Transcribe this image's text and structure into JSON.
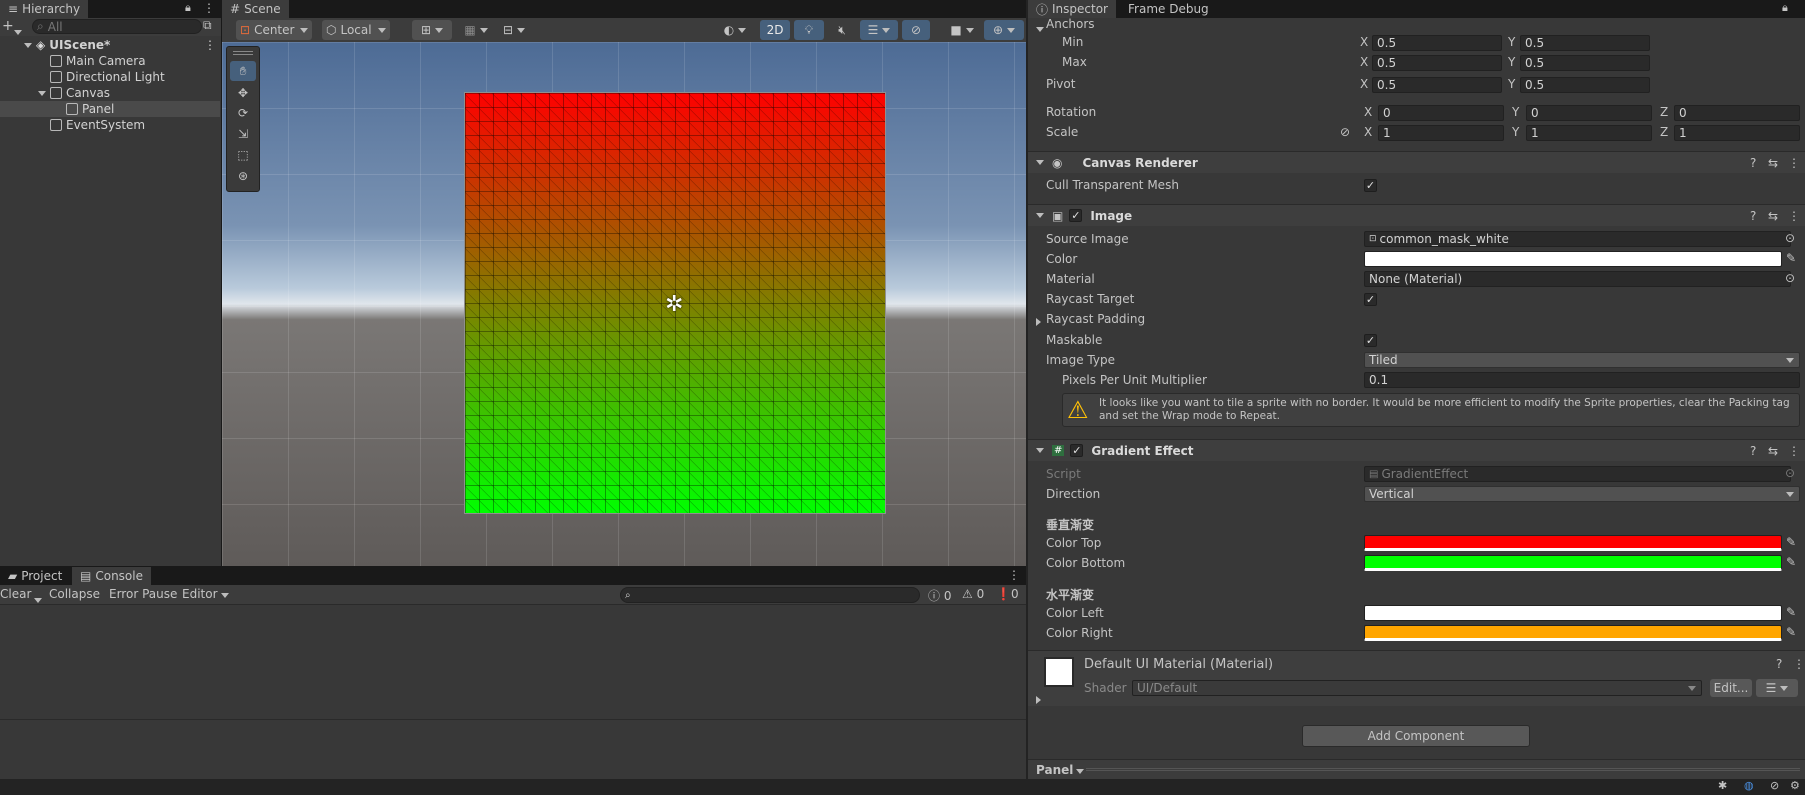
{
  "hierarchy": {
    "tab": "Hierarchy",
    "search_placeholder": "All",
    "scene": "UIScene*",
    "items": [
      "Main Camera",
      "Directional Light",
      "Canvas",
      "Panel",
      "EventSystem"
    ]
  },
  "scene_view": {
    "tab": "Scene",
    "pivot": "Center",
    "space": "Local",
    "mode_2d": "2D",
    "panel_gradient": {
      "top": "#ff0000",
      "bottom": "#00ff00"
    }
  },
  "console": {
    "tabs": [
      "Project",
      "Console"
    ],
    "clear": "Clear",
    "collapse": "Collapse",
    "error_pause": "Error Pause",
    "editor": "Editor",
    "counts": [
      "0",
      "0",
      "0"
    ]
  },
  "inspector": {
    "tabs": [
      "Inspector",
      "Frame Debug"
    ],
    "rect": {
      "anchors": "Anchors",
      "min": "Min",
      "max": "Max",
      "pivot": "Pivot",
      "rotation": "Rotation",
      "scale": "Scale",
      "min_x": "0.5",
      "min_y": "0.5",
      "max_x": "0.5",
      "max_y": "0.5",
      "pivot_x": "0.5",
      "pivot_y": "0.5",
      "rot_x": "0",
      "rot_y": "0",
      "rot_z": "0",
      "scale_x": "1",
      "scale_y": "1",
      "scale_z": "1"
    },
    "canvas_renderer": {
      "title": "Canvas Renderer",
      "cull": "Cull Transparent Mesh"
    },
    "image": {
      "title": "Image",
      "source_image_label": "Source Image",
      "source_image": "common_mask_white",
      "color_label": "Color",
      "material_label": "Material",
      "material": "None (Material)",
      "raycast_target": "Raycast Target",
      "raycast_padding": "Raycast Padding",
      "maskable": "Maskable",
      "image_type_label": "Image Type",
      "image_type": "Tiled",
      "ppu_label": "Pixels Per Unit Multiplier",
      "ppu": "0.1",
      "warning": "It looks like you want to tile a sprite with no border. It would be more efficient to modify the Sprite properties, clear the Packing tag and set the Wrap mode to Repeat."
    },
    "gradient": {
      "title": "Gradient Effect",
      "script_label": "Script",
      "script": "GradientEffect",
      "direction_label": "Direction",
      "direction": "Vertical",
      "vertical_header": "垂直渐变",
      "color_top": "Color Top",
      "color_bottom": "Color Bottom",
      "horizontal_header": "水平渐变",
      "color_left": "Color Left",
      "color_right": "Color Right",
      "colors": {
        "top": "#ff0000",
        "bottom": "#00ff00",
        "left": "#ffffff",
        "right": "#ffa500"
      }
    },
    "material": {
      "title": "Default UI Material (Material)",
      "shader_label": "Shader",
      "shader": "UI/Default",
      "edit": "Edit..."
    },
    "add_component": "Add Component",
    "footer": "Panel"
  }
}
